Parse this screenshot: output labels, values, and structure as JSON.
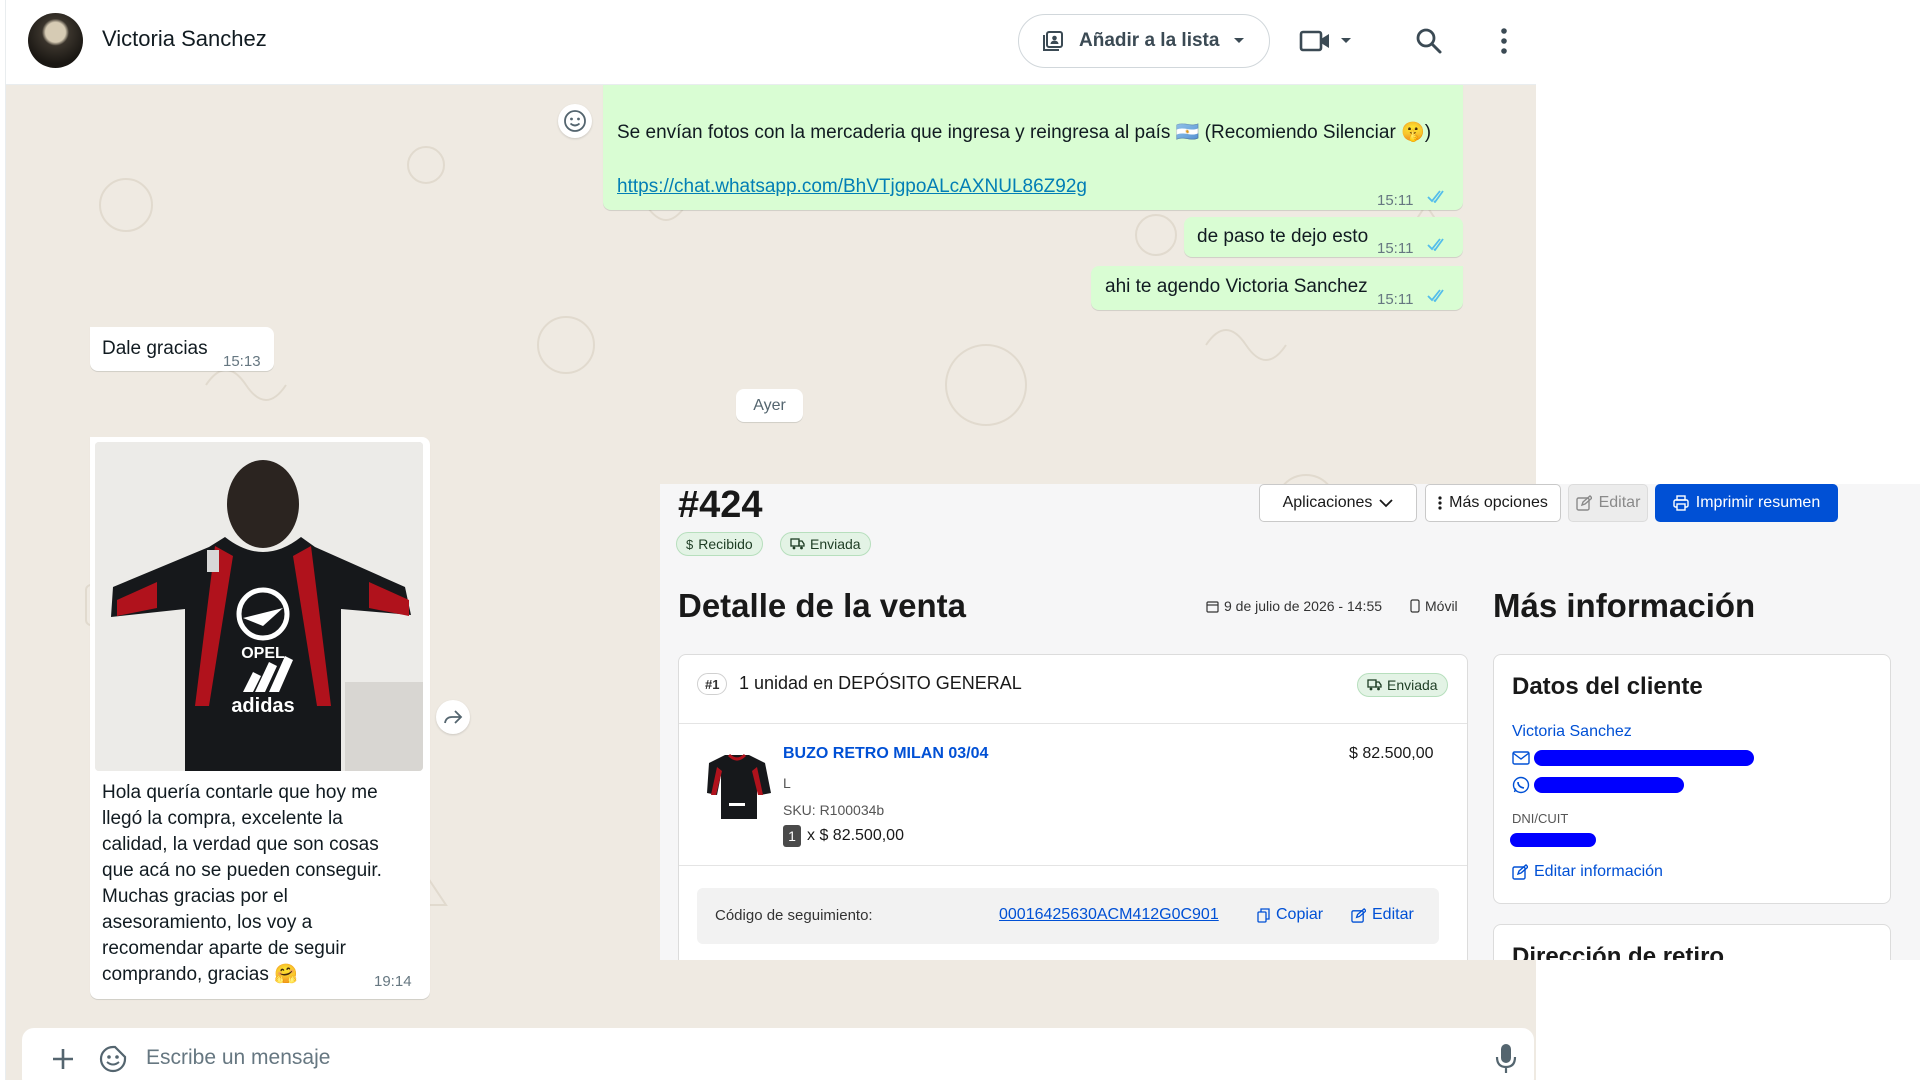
{
  "header": {
    "contact_name": "Victoria Sanchez",
    "add_to_list_label": "Añadir a la lista",
    "icons": [
      "avatar",
      "list-add-icon",
      "chevron-down-icon",
      "video-icon",
      "search-icon",
      "more-vert-icon"
    ]
  },
  "messages": [
    {
      "direction": "out",
      "text": "Se envían fotos con la mercaderia que ingresa y reingresa al país 🇦🇷 (Recomiendo Silenciar 🤫)",
      "link": "https://chat.whatsapp.com/BhVTjgpoALcAXNUL86Z92g",
      "time": "15:11",
      "status": "read"
    },
    {
      "direction": "out",
      "text": "de paso te dejo esto",
      "time": "15:11",
      "status": "read"
    },
    {
      "direction": "out",
      "text": "ahi te agendo Victoria Sanchez",
      "time": "15:11",
      "status": "read"
    },
    {
      "direction": "in",
      "text": "Dale gracias",
      "time": "15:13"
    },
    {
      "direction": "in",
      "type": "image",
      "image_description": "person wearing a black and red Adidas Opel jacket, back view",
      "caption_lines": [
        "Hola quería contarle que hoy me",
        "llegó la compra, excelente la",
        "calidad, la verdad que son cosas",
        "que acá no se pueden conseguir.",
        "Muchas gracias por el",
        "asesoramiento, los voy a",
        "recomendar aparte de seguir",
        "comprando, gracias 🤗"
      ],
      "time": "19:14"
    }
  ],
  "day_divider": "Ayer",
  "composer": {
    "placeholder": "Escribe un mensaje"
  },
  "order": {
    "number": "#424",
    "buttons": {
      "apps": "Aplicaciones",
      "more": "Más opciones",
      "edit": "Editar",
      "print": "Imprimir resumen"
    },
    "status_pills": [
      "Recibido",
      "Enviada"
    ],
    "sale_detail_title": "Detalle de la venta",
    "date": "9 de julio de 2026 - 14:55",
    "channel": "Móvil",
    "shipment": {
      "index": "#1",
      "summary": "1 unidad en DEPÓSITO GENERAL",
      "status": "Enviada",
      "item": {
        "name": "BUZO RETRO MILAN 03/04",
        "variant": "L",
        "sku": "SKU: R100034b",
        "qty": "1",
        "unit_price": "x $ 82.500,00",
        "total": "$ 82.500,00"
      },
      "tracking_label": "Código de seguimiento:",
      "tracking_code": "00016425630ACM412G0C901",
      "copy_label": "Copiar",
      "edit_label": "Editar"
    },
    "more_info": {
      "title": "Más información",
      "client_title": "Datos del cliente",
      "client_name": "Victoria Sanchez",
      "dni_label": "DNI/CUIT",
      "edit_info_label": "Editar información",
      "pickup_title": "Dirección de retiro"
    }
  },
  "colors": {
    "outgoing_bubble": "#d9fdd3",
    "chat_bg": "#efeae2",
    "primary_button": "#0050d5",
    "link": "#027eb5",
    "read_ticks": "#53bdeb",
    "redaction": "#0000ff"
  }
}
